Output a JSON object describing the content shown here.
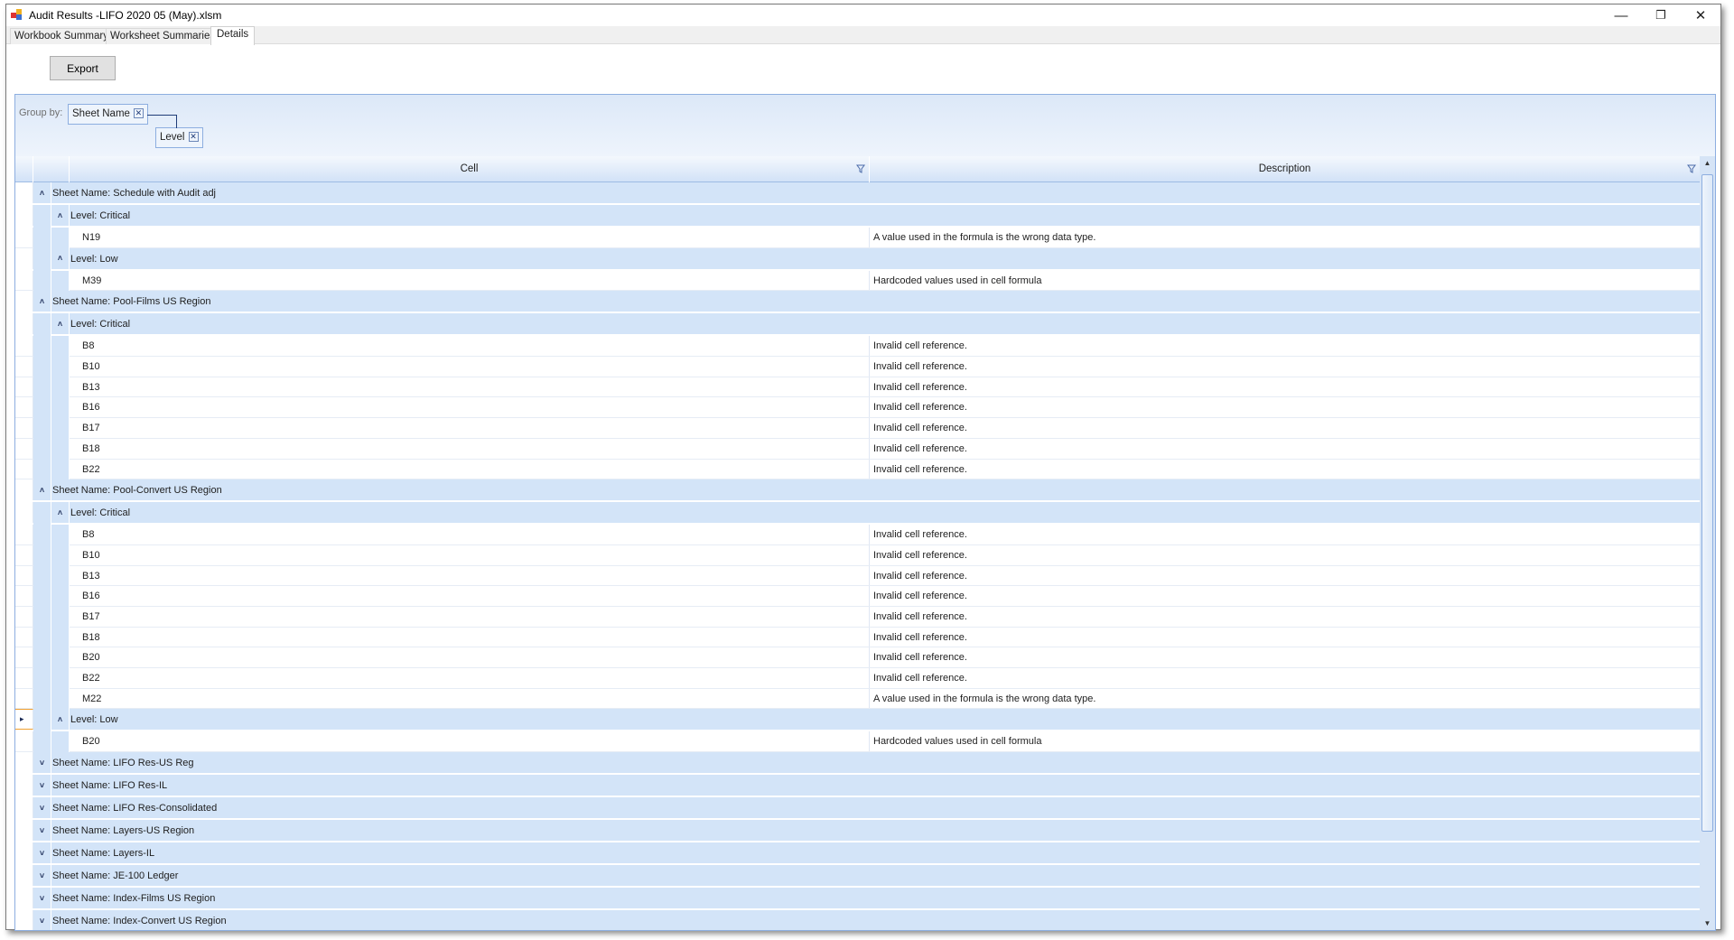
{
  "window": {
    "title": "Audit Results -LIFO 2020 05 (May).xlsm",
    "minimize_icon": "minimize-icon",
    "restore_icon": "restore-icon",
    "close_icon": "close-icon"
  },
  "tabs": [
    {
      "label": "Workbook Summary"
    },
    {
      "label": "Worksheet Summaries"
    },
    {
      "label": "Details",
      "active": true
    }
  ],
  "toolbar": {
    "export_label": "Export"
  },
  "group_panel": {
    "label": "Group by:",
    "chips": [
      {
        "label": "Sheet Name"
      },
      {
        "label": "Level"
      }
    ]
  },
  "columns": [
    {
      "label": "Cell",
      "filter_icon": "funnel-icon"
    },
    {
      "label": "Description",
      "filter_icon": "funnel-icon"
    }
  ],
  "groups": [
    {
      "label": "Sheet Name: Schedule with Audit adj",
      "expanded": true,
      "levels": [
        {
          "label": "Level: Critical",
          "items": [
            {
              "cell": "N19",
              "description": "A value used in the formula is the wrong data type."
            }
          ]
        },
        {
          "label": "Level: Low",
          "items": [
            {
              "cell": "M39",
              "description": "Hardcoded values used in cell formula"
            }
          ]
        }
      ]
    },
    {
      "label": "Sheet Name: Pool-Films US Region",
      "expanded": true,
      "levels": [
        {
          "label": "Level: Critical",
          "items": [
            {
              "cell": "B8",
              "description": "Invalid cell reference."
            },
            {
              "cell": "B10",
              "description": "Invalid cell reference."
            },
            {
              "cell": "B13",
              "description": "Invalid cell reference."
            },
            {
              "cell": "B16",
              "description": "Invalid cell reference."
            },
            {
              "cell": "B17",
              "description": "Invalid cell reference."
            },
            {
              "cell": "B18",
              "description": "Invalid cell reference."
            },
            {
              "cell": "B22",
              "description": "Invalid cell reference."
            }
          ]
        }
      ]
    },
    {
      "label": "Sheet Name: Pool-Convert US Region",
      "expanded": true,
      "levels": [
        {
          "label": "Level: Critical",
          "items": [
            {
              "cell": "B8",
              "description": "Invalid cell reference."
            },
            {
              "cell": "B10",
              "description": "Invalid cell reference."
            },
            {
              "cell": "B13",
              "description": "Invalid cell reference."
            },
            {
              "cell": "B16",
              "description": "Invalid cell reference."
            },
            {
              "cell": "B17",
              "description": "Invalid cell reference."
            },
            {
              "cell": "B18",
              "description": "Invalid cell reference."
            },
            {
              "cell": "B20",
              "description": "Invalid cell reference."
            },
            {
              "cell": "B22",
              "description": "Invalid cell reference."
            },
            {
              "cell": "M22",
              "description": "A value used in the formula is the wrong data type."
            }
          ]
        },
        {
          "label": "Level: Low",
          "current": true,
          "items": [
            {
              "cell": "B20",
              "description": "Hardcoded values used in cell formula"
            }
          ]
        }
      ]
    },
    {
      "label": "Sheet Name: LIFO Res-US Reg",
      "expanded": false
    },
    {
      "label": "Sheet Name: LIFO Res-IL",
      "expanded": false
    },
    {
      "label": "Sheet Name: LIFO Res-Consolidated",
      "expanded": false
    },
    {
      "label": "Sheet Name: Layers-US Region",
      "expanded": false
    },
    {
      "label": "Sheet Name: Layers-IL",
      "expanded": false
    },
    {
      "label": "Sheet Name: JE-100 Ledger",
      "expanded": false
    },
    {
      "label": "Sheet Name: Index-Films US Region",
      "expanded": false
    },
    {
      "label": "Sheet Name: Index-Convert US Region",
      "expanded": false
    }
  ],
  "colors": {
    "group_row": "#d3e4f8",
    "panel_border": "#8daee0",
    "current_row_marker": "#f0a030"
  }
}
